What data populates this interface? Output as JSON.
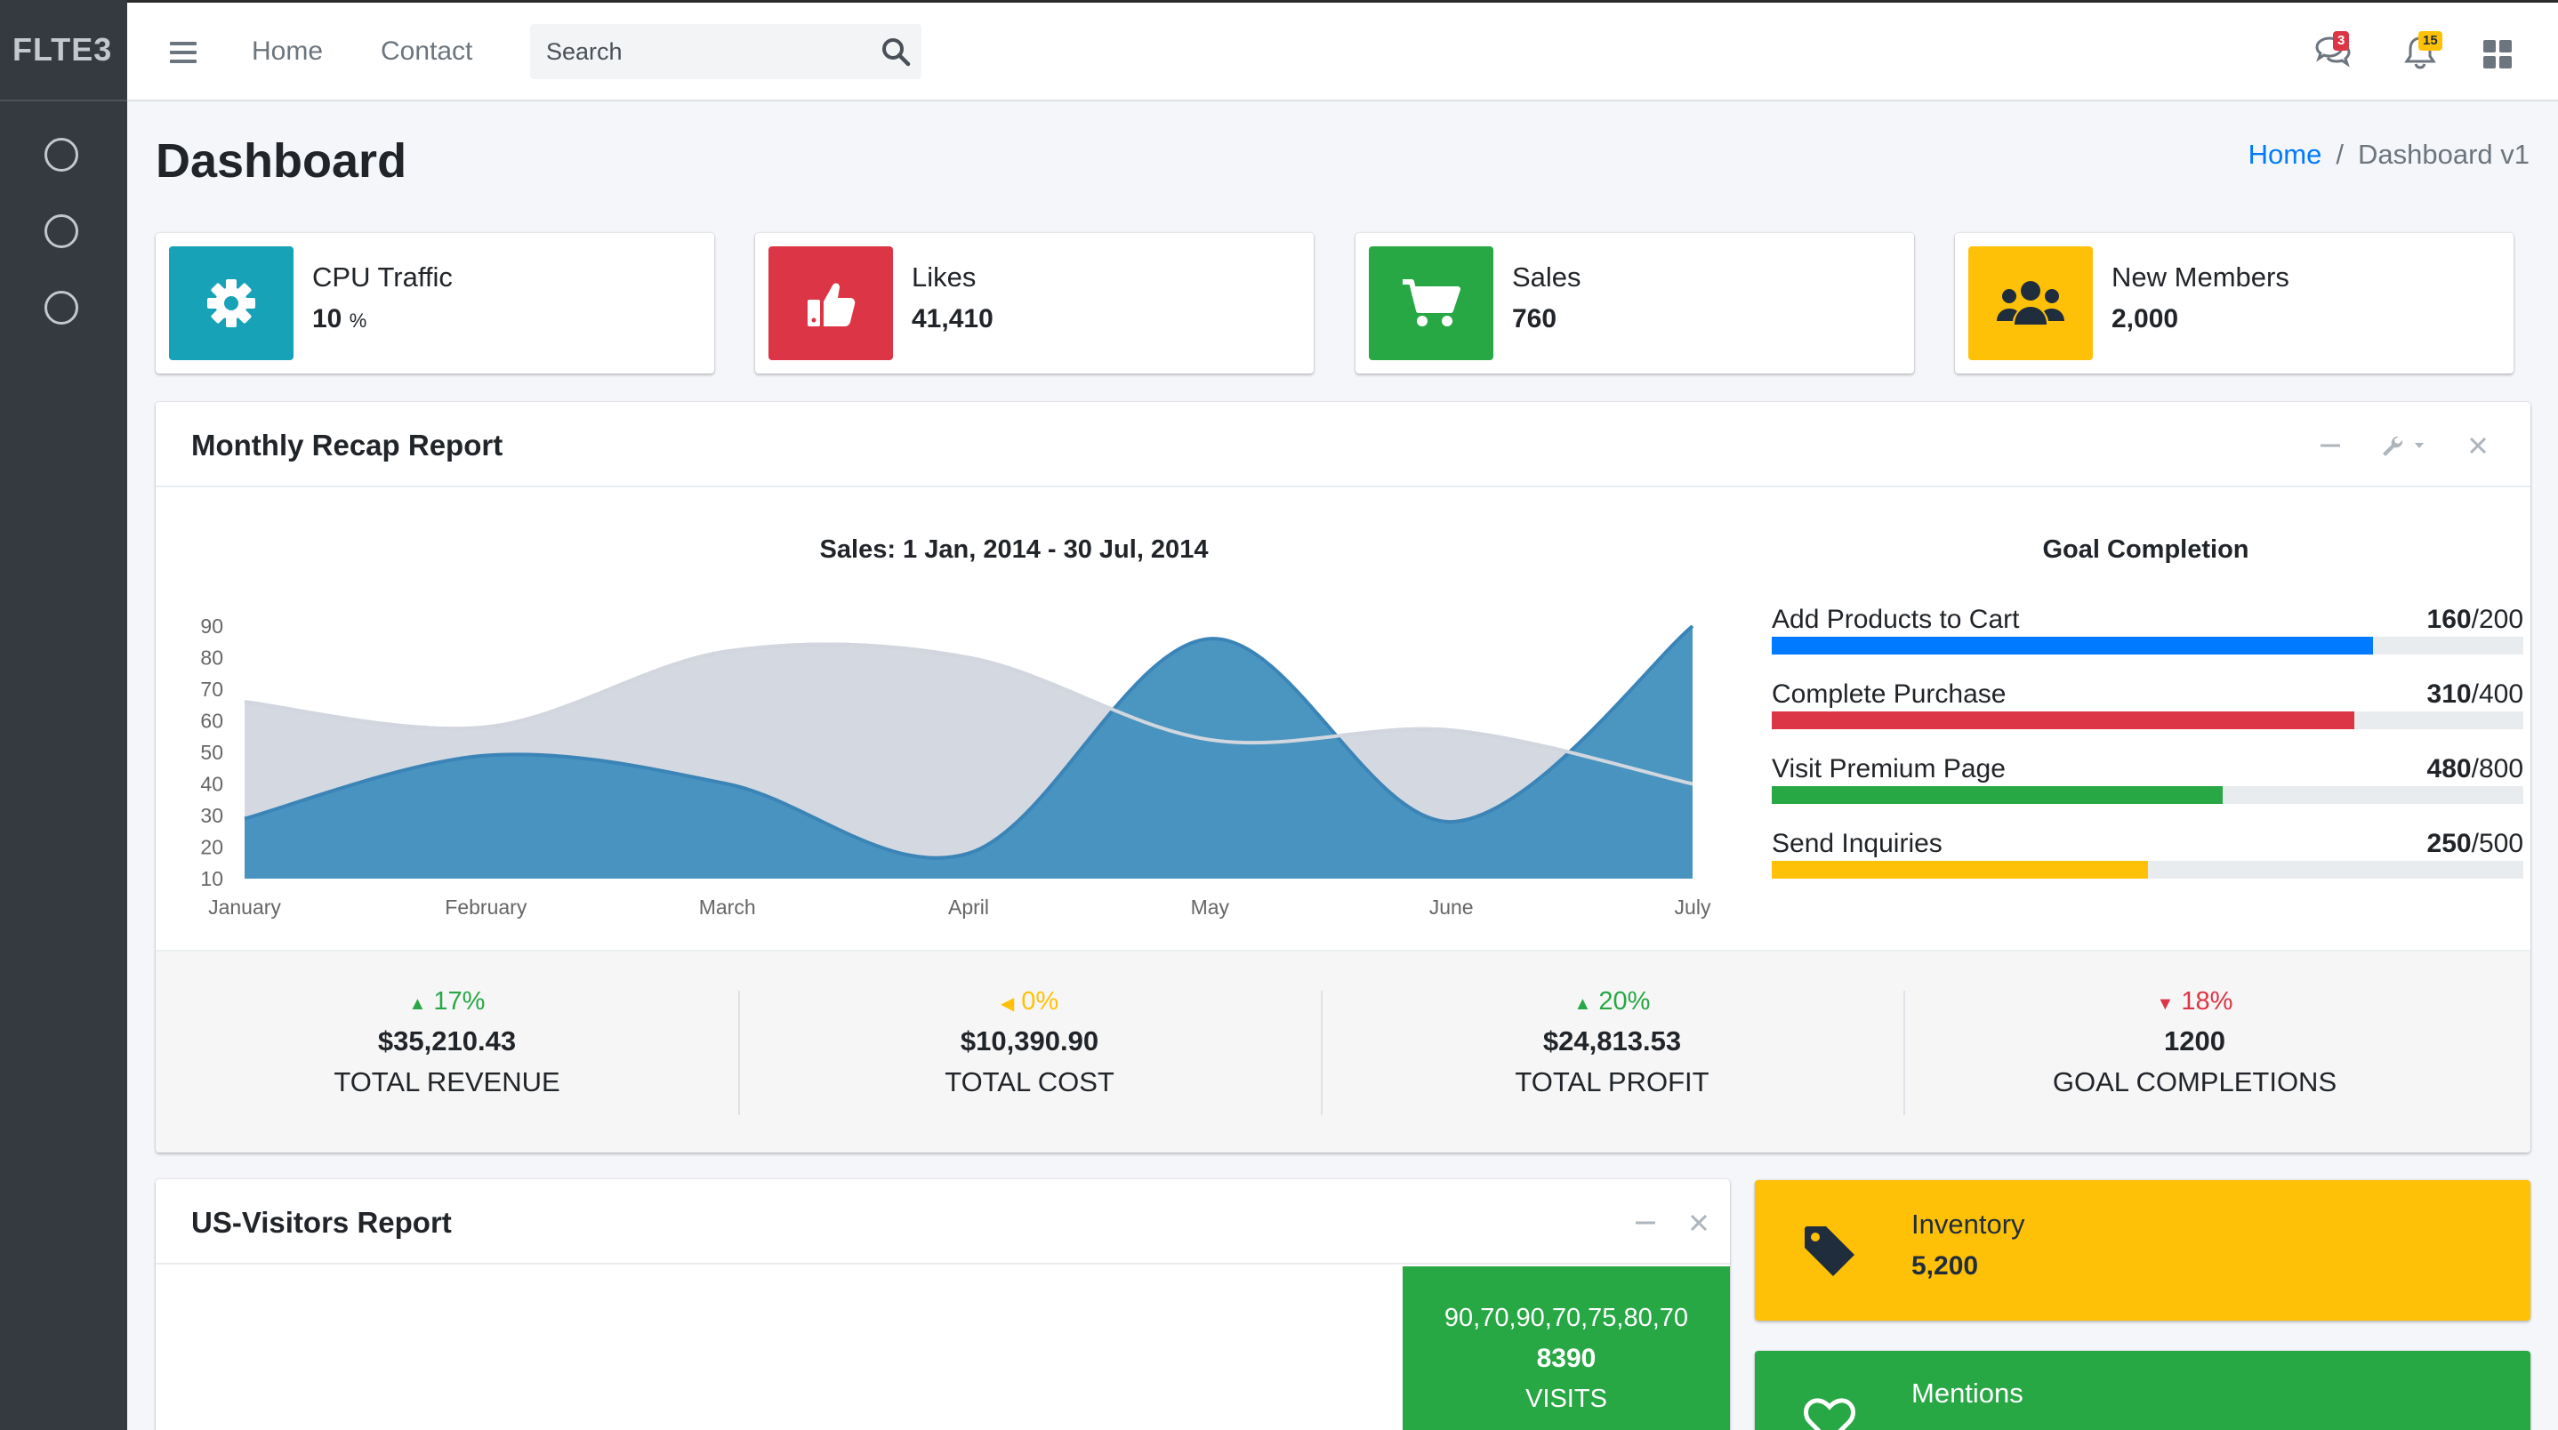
{
  "brand": {
    "name": "FLTE3"
  },
  "topnav": {
    "home": "Home",
    "contact": "Contact",
    "search_placeholder": "Search",
    "messages_count": "3",
    "notifications_count": "15"
  },
  "page": {
    "title": "Dashboard",
    "breadcrumb": [
      "Home",
      "/",
      "Dashboard v1"
    ]
  },
  "info_boxes": [
    {
      "label": "CPU Traffic",
      "value": "10",
      "unit": "%",
      "icon": "gear-icon",
      "color": "#17a2b8"
    },
    {
      "label": "Likes",
      "value": "41,410",
      "icon": "thumbs-up-icon",
      "color": "#dc3545"
    },
    {
      "label": "Sales",
      "value": "760",
      "icon": "shopping-cart-icon",
      "color": "#28a745"
    },
    {
      "label": "New Members",
      "value": "2,000",
      "icon": "users-icon",
      "color": "#ffc107"
    }
  ],
  "recap": {
    "title": "Monthly Recap Report",
    "goal_title": "Goal Completion",
    "goals": [
      {
        "label": "Add Products to Cart",
        "value": "160",
        "total": "/200",
        "fraction": 0.8,
        "color": "#007bff"
      },
      {
        "label": "Complete Purchase",
        "value": "310",
        "total": "/400",
        "fraction": 0.775,
        "color": "#dc3545"
      },
      {
        "label": "Visit Premium Page",
        "value": "480",
        "total": "/800",
        "fraction": 0.6,
        "color": "#28a745"
      },
      {
        "label": "Send Inquiries",
        "value": "250",
        "total": "/500",
        "fraction": 0.5,
        "color": "#ffc107"
      }
    ],
    "stats": [
      {
        "pct": "17%",
        "dir": "up",
        "color": "#28a745",
        "amount": "$35,210.43",
        "label": "TOTAL REVENUE"
      },
      {
        "pct": "0%",
        "dir": "left",
        "color": "#ffc107",
        "amount": "$10,390.90",
        "label": "TOTAL COST"
      },
      {
        "pct": "20%",
        "dir": "up",
        "color": "#28a745",
        "amount": "$24,813.53",
        "label": "TOTAL PROFIT"
      },
      {
        "pct": "18%",
        "dir": "down",
        "color": "#dc3545",
        "amount": "1200",
        "label": "GOAL COMPLETIONS"
      }
    ]
  },
  "chart_data": {
    "type": "area",
    "title": "Sales: 1 Jan, 2014 - 30 Jul, 2014",
    "categories": [
      "January",
      "February",
      "March",
      "April",
      "May",
      "June",
      "July"
    ],
    "ylim": [
      10,
      90
    ],
    "yticks": [
      10,
      20,
      30,
      40,
      50,
      60,
      70,
      80,
      90
    ],
    "series": [
      {
        "values": [
          66,
          58,
          82,
          80,
          54,
          57,
          40
        ],
        "color": "#d2d6de"
      },
      {
        "values": [
          29,
          49,
          40,
          18,
          86,
          28,
          90
        ],
        "color": "#3c8dbc"
      }
    ]
  },
  "visitors": {
    "title": "US-Visitors Report",
    "sparkline_values": "90,70,90,70,75,80,70",
    "visits": "8390",
    "visits_label": "VISITS",
    "green": "#28a745"
  },
  "small_boxes": [
    {
      "title": "Inventory",
      "value": "5,200",
      "icon": "tag-icon",
      "color": "#ffc107"
    },
    {
      "title": "Mentions",
      "icon": "heart-icon",
      "color": "#28a745"
    }
  ]
}
